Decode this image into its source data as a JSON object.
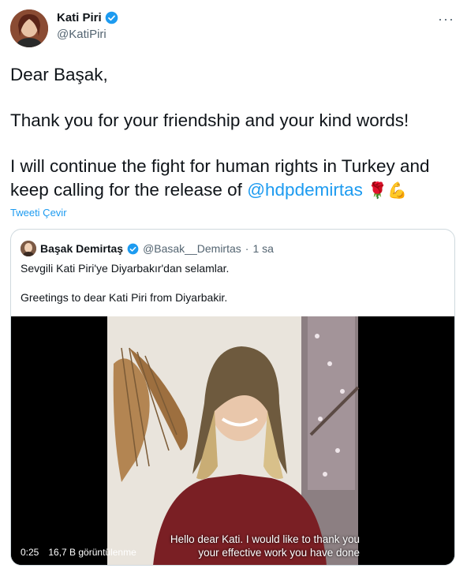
{
  "tweet": {
    "author_name": "Kati Piri",
    "author_handle": "@KatiPiri",
    "more_icon": "more-icon",
    "text_lines": [
      "Dear Başak,",
      "Thank you for your friendship and your kind words!",
      "I will continue the fight for human rights in Turkey and keep calling for the release of "
    ],
    "mention": "@hdpdemirtas",
    "emojis": [
      "🌹",
      "💪"
    ],
    "translate_label": "Tweeti Çevir"
  },
  "quoted": {
    "author_name": "Başak Demirtaş",
    "author_handle": "@Basak__Demirtas",
    "separator": "·",
    "time": "1 sa",
    "text_tr": "Sevgili Kati Piri'ye Diyarbakır'dan selamlar.",
    "text_en": "Greetings to dear Kati Piri from Diyarbakir.",
    "video": {
      "elapsed": "0:25",
      "views": "16,7 B görüntülenme",
      "subtitle_line1": "Hello dear Kati. I would like to thank you",
      "subtitle_line2": "your effective work you have done"
    }
  },
  "colors": {
    "accent": "#1d9bf0",
    "text": "#0f1419",
    "muted": "#536471",
    "border": "#cfd9de"
  }
}
